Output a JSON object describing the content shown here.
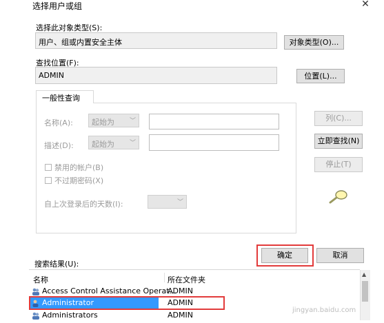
{
  "window": {
    "title": "选择用户或组"
  },
  "object_type": {
    "label": "选择此对象类型(S):",
    "value": "用户、组或内置安全主体",
    "button": "对象类型(O)..."
  },
  "location": {
    "label": "查找位置(F):",
    "value": "ADMIN",
    "button": "位置(L)..."
  },
  "query": {
    "tab": "一般性查询",
    "name_label": "名称(A):",
    "name_combo": "起始为",
    "desc_label": "描述(D):",
    "desc_combo": "起始为",
    "disabled_accounts": "禁用的帐户(B)",
    "no_expire_pw": "不过期密码(X)",
    "days_label": "自上次登录后的天数(I):"
  },
  "side_buttons": {
    "columns": "列(C)...",
    "find_now": "立即查找(N)",
    "stop": "停止(T)"
  },
  "footer": {
    "ok": "确定",
    "cancel": "取消",
    "results_label": "搜索结果(U):"
  },
  "results": {
    "columns": [
      "名称",
      "所在文件夹"
    ],
    "rows": [
      {
        "name": "Access Control Assistance Operat...",
        "folder": "ADMIN",
        "selected": false
      },
      {
        "name": "Administrator",
        "folder": "ADMIN",
        "selected": true
      },
      {
        "name": "Administrators",
        "folder": "ADMIN",
        "selected": false
      }
    ]
  },
  "watermark": "jingyan.baidu.com",
  "colors": {
    "highlight": "#e23a3a",
    "selection": "#3399ff"
  }
}
